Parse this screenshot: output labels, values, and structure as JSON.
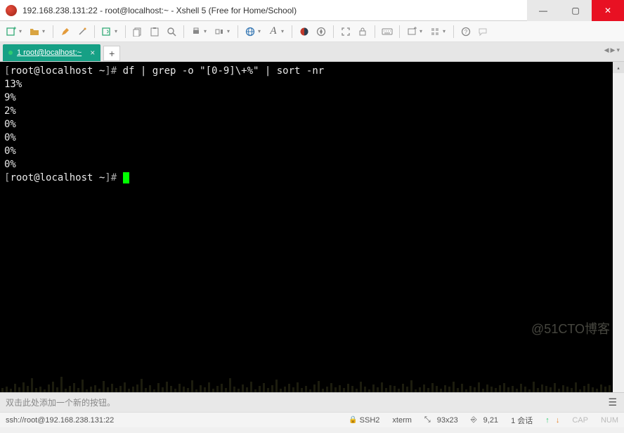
{
  "titlebar": {
    "text": "192.168.238.131:22 - root@localhost:~ - Xshell 5 (Free for Home/School)"
  },
  "tab": {
    "label": "1 root@localhost:~"
  },
  "terminal": {
    "prompt1_open": "[",
    "prompt1_user": "root@localhost ~",
    "prompt1_close": "]# ",
    "command": "df | grep -o \"[0-9]\\+%\" | sort -nr",
    "output": [
      "13%",
      "9%",
      "2%",
      "0%",
      "0%",
      "0%",
      "0%"
    ],
    "prompt2_open": "[",
    "prompt2_user": "root@localhost ~",
    "prompt2_close": "]# "
  },
  "bottombar": {
    "hint": "双击此处添加一个新的按钮。"
  },
  "statusbar": {
    "conn": "ssh://root@192.168.238.131:22",
    "proto": "SSH2",
    "term": "xterm",
    "size": "93x23",
    "cursor": "9,21",
    "sessions": "1 会话",
    "cap": "CAP",
    "num": "NUM"
  },
  "watermark": "@51CTO博客"
}
